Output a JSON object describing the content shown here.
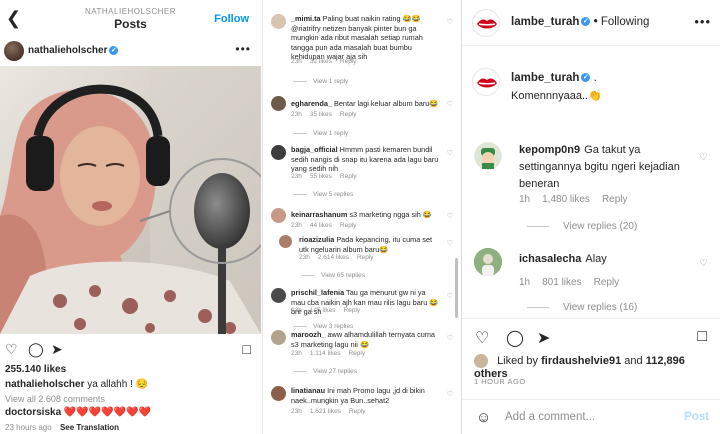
{
  "left_post": {
    "header_username": "NATHALIEHOLSCHER",
    "title": "Posts",
    "follow_label": "Follow",
    "author": "nathalieholscher",
    "likes": "255.140 likes",
    "caption_user": "nathalieholscher",
    "caption_text": "ya allahh ! 😔",
    "view_all": "View all 2.608 comments",
    "comment_user": "doctorsiska",
    "comment_text": "❤️❤️❤️❤️❤️❤️❤️",
    "time": "23 hours ago",
    "see_translation": "See Translation"
  },
  "middle_comments": [
    {
      "user": "_mimi.ta",
      "text": "Paling buat naikin rating 😂😂 @riatrifry netizen banyak pinter bun ga mungkin ada ribut masalah setiap rumah tangga pun ada masalah buat bumbu kehidupan wajar aja sih",
      "time": "23h",
      "likes": "32 likes",
      "reply": "Reply",
      "replies": "View 1 reply"
    },
    {
      "user": "egharenda_",
      "text": "Bentar lagi keluar album baru😂",
      "time": "23h",
      "likes": "35 likes",
      "reply": "Reply",
      "replies": "View 1 reply"
    },
    {
      "user": "bagja_official",
      "text": "Hmmm pasti kemaren bundil sedih nangis di snap itu karena ada lagu baru yang sedih nih",
      "time": "23h",
      "likes": "55 likes",
      "reply": "Reply",
      "replies": "View 5 replies"
    },
    {
      "user": "keinarrashanum",
      "text": "s3 marketing ngga sih 😂",
      "time": "23h",
      "likes": "44 likes",
      "reply": "Reply",
      "replies": ""
    },
    {
      "user": "rioazizulia",
      "text": "Pada kepancing, itu cuma set utk ngeluarin album baru😂",
      "time": "23h",
      "likes": "2.614 likes",
      "reply": "Reply",
      "replies": "View 65 replies"
    },
    {
      "user": "prischil_lafenia",
      "text": "Tau ga menurut gw ni ya mau cba naikin ajh kan mau rilis lagu baru 😂 bnr ga sh",
      "time": "23h",
      "likes": "145 likes",
      "reply": "Reply",
      "replies": "View 3 replies"
    },
    {
      "user": "maroozh_",
      "text": "aww alhamdulillah ternyata cuma s3 marketing lagu nii 😂",
      "time": "23h",
      "likes": "1.114 likes",
      "reply": "Reply",
      "replies": "View 27 replies"
    },
    {
      "user": "linatianau",
      "text": "Ini mah Promo lagu ,jd di bikin naek..mungkin ya Bun..sehat2",
      "time": "23h",
      "likes": "1.621 likes",
      "reply": "Reply",
      "replies": ""
    }
  ],
  "right_post": {
    "account": "lambe_turah",
    "follow_state": "Following",
    "caption_user": "lambe_turah",
    "caption_dot": ".",
    "caption_text": "Komennnyaaa..👏",
    "comments": [
      {
        "user": "kepomp0n9",
        "text": "Ga takut ya settingannya bgitu ngeri kejadian beneran",
        "time": "1h",
        "likes": "1,480 likes",
        "reply": "Reply",
        "view_replies": "View replies (20)"
      },
      {
        "user": "ichasalecha",
        "text": "Alay",
        "time": "1h",
        "likes": "801 likes",
        "reply": "Reply",
        "view_replies": "View replies (16)"
      }
    ],
    "liked_by_prefix": "Liked by",
    "liked_by_user": "firdaushelvie91",
    "liked_by_and": "and",
    "liked_by_others": "112,896 others",
    "time": "1 HOUR AGO",
    "add_comment_placeholder": "Add a comment...",
    "post_label": "Post"
  },
  "colors": {
    "link_blue": "#0095f6",
    "verified_blue": "#3897f0",
    "muted_text": "#8e8e8e",
    "heart_red": "#ed4956",
    "post_disabled": "#b2dffc"
  }
}
